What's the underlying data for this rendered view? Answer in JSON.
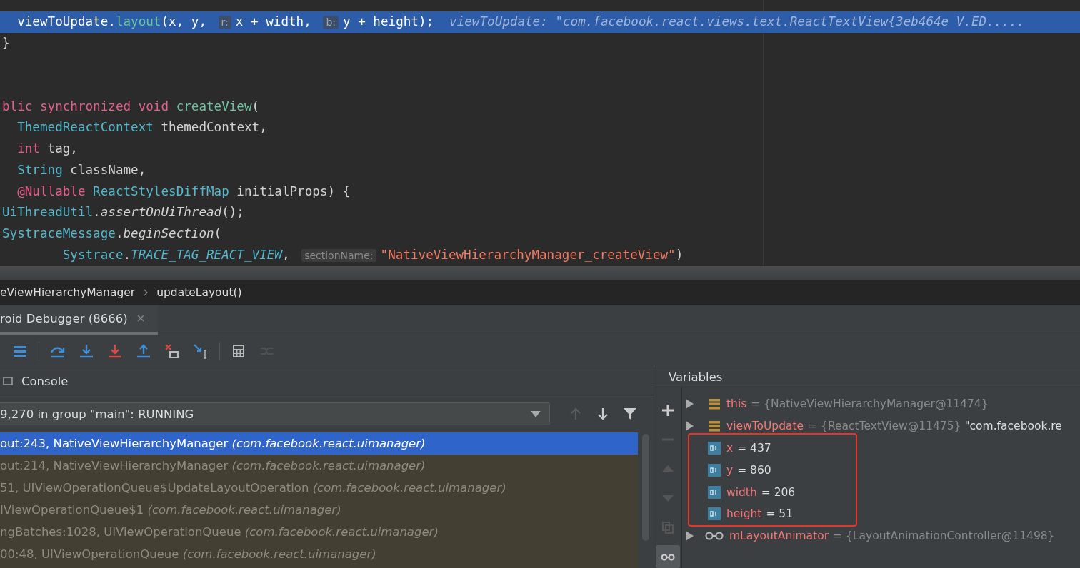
{
  "editor": {
    "lines": [
      {
        "selected": true,
        "tokens": [
          {
            "kind": "plain",
            "text": "  viewToUpdate."
          },
          {
            "kind": "method",
            "text": "layout"
          },
          {
            "kind": "plain",
            "text": "(x, y, "
          },
          {
            "kind": "hint",
            "text": "r:"
          },
          {
            "kind": "plain",
            "text": "x + width, "
          },
          {
            "kind": "hint",
            "text": "b:"
          },
          {
            "kind": "plain",
            "text": "y + height);"
          },
          {
            "kind": "inline-value",
            "text": "viewToUpdate: \"com.facebook.react.views.text.ReactTextView{3eb464e V.ED....."
          }
        ]
      },
      {
        "selected": false,
        "tokens": [
          {
            "kind": "plain",
            "text": "}"
          }
        ]
      },
      {
        "selected": false
      },
      {
        "selected": false
      },
      {
        "selected": false,
        "tokens": [
          {
            "kind": "keyword",
            "text": "blic synchronized void "
          },
          {
            "kind": "method",
            "text": "createView"
          },
          {
            "kind": "plain",
            "text": "("
          }
        ]
      },
      {
        "selected": false,
        "tokens": [
          {
            "kind": "type",
            "text": "  ThemedReactContext"
          },
          {
            "kind": "plain",
            "text": " themedContext,"
          }
        ]
      },
      {
        "selected": false,
        "tokens": [
          {
            "kind": "keyword",
            "text": "  int"
          },
          {
            "kind": "plain",
            "text": " tag,"
          }
        ]
      },
      {
        "selected": false,
        "tokens": [
          {
            "kind": "type",
            "text": "  String"
          },
          {
            "kind": "plain",
            "text": " className,"
          }
        ]
      },
      {
        "selected": false,
        "tokens": [
          {
            "kind": "keyword",
            "text": "  @Nullable "
          },
          {
            "kind": "type",
            "text": "ReactStylesDiffMap"
          },
          {
            "kind": "plain",
            "text": " initialProps) {"
          }
        ]
      },
      {
        "selected": false,
        "tokens": [
          {
            "kind": "type",
            "text": "UiThreadUtil"
          },
          {
            "kind": "plain",
            "text": "."
          },
          {
            "kind": "italic",
            "text": "assertOnUiThread"
          },
          {
            "kind": "plain",
            "text": "();"
          }
        ]
      },
      {
        "selected": false,
        "tokens": [
          {
            "kind": "type",
            "text": "SystraceMessage"
          },
          {
            "kind": "plain",
            "text": "."
          },
          {
            "kind": "italic",
            "text": "beginSection"
          },
          {
            "kind": "plain",
            "text": "("
          }
        ]
      },
      {
        "selected": false,
        "tokens": [
          {
            "kind": "type",
            "text": "        Systrace"
          },
          {
            "kind": "plain",
            "text": "."
          },
          {
            "kind": "constant",
            "text": "TRACE_TAG_REACT_VIEW"
          },
          {
            "kind": "plain",
            "text": ", "
          },
          {
            "kind": "hint",
            "text": "sectionName:"
          },
          {
            "kind": "string",
            "text": "\"NativeViewHierarchyManager_createView\""
          },
          {
            "kind": "plain",
            "text": ")"
          }
        ]
      }
    ]
  },
  "breadcrumbs": [
    "eViewHierarchyManager",
    "updateLayout()"
  ],
  "debug_tab": {
    "label": "roid Debugger (8666)",
    "selected": true
  },
  "toolbar": [
    {
      "kind": "frames",
      "disabled": false
    },
    {
      "kind": "step-over",
      "disabled": false
    },
    {
      "kind": "step-into",
      "disabled": false
    },
    {
      "kind": "force-step-into",
      "disabled": false
    },
    {
      "kind": "step-out",
      "disabled": false
    },
    {
      "kind": "drop-frame",
      "disabled": false
    },
    {
      "kind": "run-to-cursor",
      "disabled": false
    },
    {
      "kind": "evaluate",
      "disabled": false
    },
    {
      "kind": "trace",
      "disabled": true
    }
  ],
  "console_tab": {
    "label": "Console"
  },
  "frames": {
    "thread": "9,270 in group \"main\": RUNNING",
    "nav": [
      {
        "kind": "up",
        "disabled": true
      },
      {
        "kind": "down",
        "disabled": false
      },
      {
        "kind": "filter",
        "disabled": false
      }
    ],
    "rows": [
      {
        "method": "out:243, NativeViewHierarchyManager",
        "package": "(com.facebook.react.uimanager)",
        "selected": true
      },
      {
        "method": "out:214, NativeViewHierarchyManager",
        "package": "(com.facebook.react.uimanager)",
        "selected": false
      },
      {
        "method": "51, UIViewOperationQueue$UpdateLayoutOperation",
        "package": "(com.facebook.react.uimanager)",
        "selected": false
      },
      {
        "method": "IViewOperationQueue$1",
        "package": "(com.facebook.react.uimanager)",
        "selected": false
      },
      {
        "method": "ngBatches:1028, UIViewOperationQueue",
        "package": "(com.facebook.react.uimanager)",
        "selected": false
      },
      {
        "method": "00:48, UIViewOperationQueue",
        "package": "(com.facebook.react.uimanager)",
        "selected": false
      }
    ]
  },
  "variables": {
    "title": "Variables",
    "side": [
      {
        "kind": "add",
        "disabled": false,
        "selected": false
      },
      {
        "kind": "remove",
        "disabled": true,
        "selected": false
      },
      {
        "kind": "up",
        "disabled": true,
        "selected": false
      },
      {
        "kind": "down",
        "disabled": true,
        "selected": false
      },
      {
        "kind": "copy",
        "disabled": true,
        "selected": false
      },
      {
        "kind": "watches",
        "disabled": false,
        "selected": true
      }
    ],
    "items": [
      {
        "kind": "object",
        "name": "this",
        "value": "= {NativeViewHierarchyManager@11474}",
        "expanded": false
      },
      {
        "kind": "object",
        "name": "viewToUpdate",
        "value": "= {ReactTextView@11475}",
        "extra": "\"com.facebook.re",
        "expanded": false
      },
      {
        "kind": "primitive",
        "name": "x",
        "value": "= 437"
      },
      {
        "kind": "primitive",
        "name": "y",
        "value": "= 860"
      },
      {
        "kind": "primitive",
        "name": "width",
        "value": "= 206"
      },
      {
        "kind": "primitive",
        "name": "height",
        "value": "= 51"
      },
      {
        "kind": "watch",
        "name": "mLayoutAnimator",
        "value": "= {LayoutAnimationController@11498}",
        "expanded": false
      }
    ]
  }
}
